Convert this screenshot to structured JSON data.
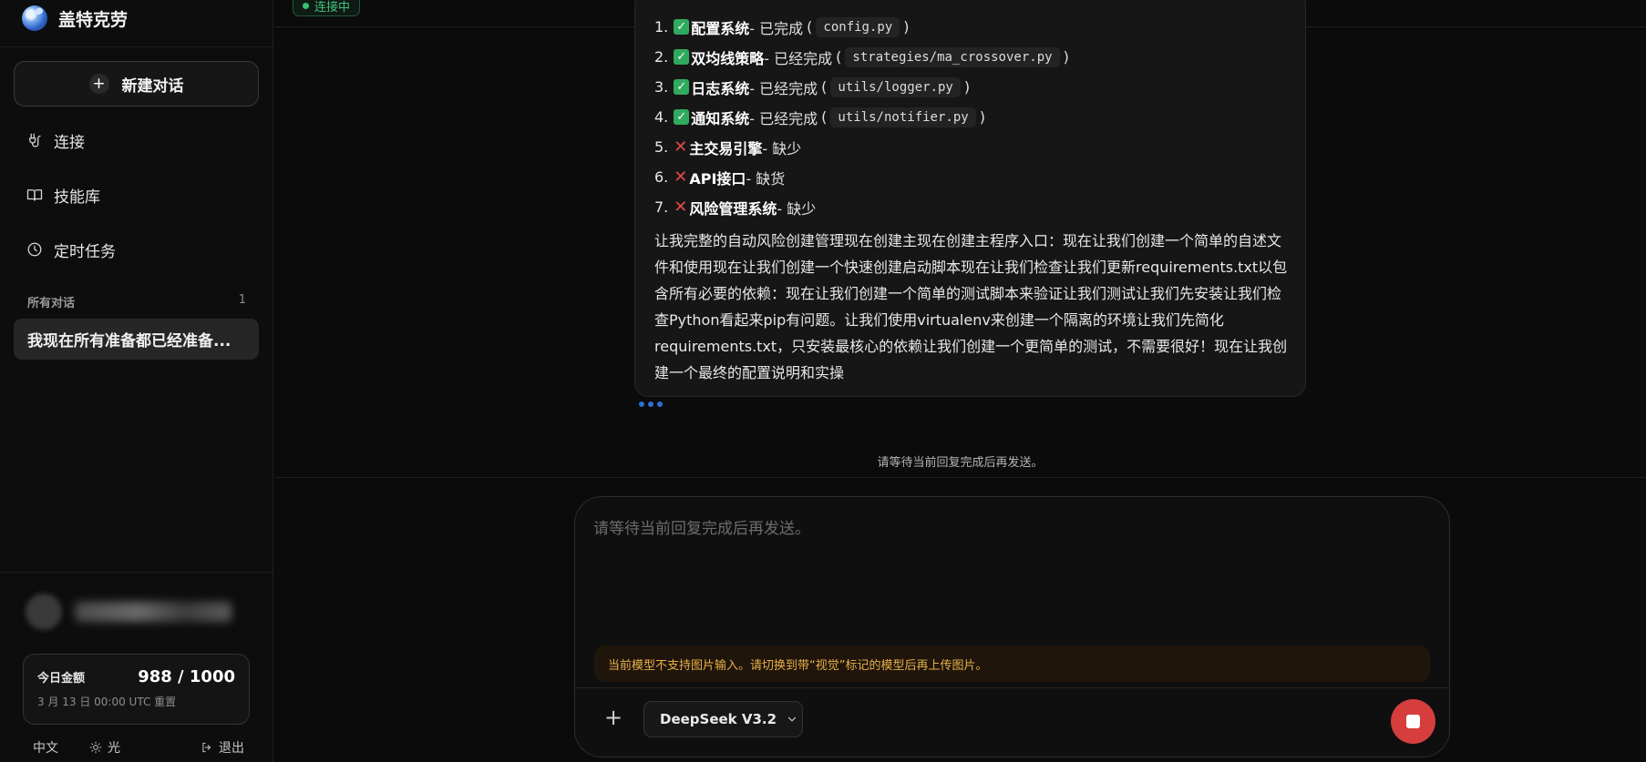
{
  "app": {
    "name": "盖特克劳"
  },
  "sidebar": {
    "new_chat_label": "新建对话",
    "nav": [
      {
        "label": "连接",
        "icon": "plug-icon"
      },
      {
        "label": "技能库",
        "icon": "book-icon"
      },
      {
        "label": "定时任务",
        "icon": "clock-icon"
      }
    ],
    "conversations_header": "所有对话",
    "conversations_count": "1",
    "conversations": [
      {
        "title": "我现在所有准备都已经准备..."
      }
    ],
    "quota": {
      "label": "今日金额",
      "value": "988 / 1000",
      "reset": "3 月 13 日 00:00 UTC 重置"
    },
    "footer": {
      "language": "中文",
      "theme": "光",
      "logout": "退出"
    }
  },
  "header": {
    "status": "连接中",
    "status_color": "#36c271"
  },
  "message": {
    "items": [
      {
        "num": "1.",
        "mark": "ok",
        "title": "配置系统",
        "status": "- 已完成",
        "code": "config.py"
      },
      {
        "num": "2.",
        "mark": "ok",
        "title": "双均线策略",
        "status": "- 已经完成",
        "code": "strategies/ma_crossover.py"
      },
      {
        "num": "3.",
        "mark": "ok",
        "title": "日志系统",
        "status": "- 已经完成",
        "code": "utils/logger.py"
      },
      {
        "num": "4.",
        "mark": "ok",
        "title": "通知系统",
        "status": "- 已经完成",
        "code": "utils/notifier.py"
      },
      {
        "num": "5.",
        "mark": "no",
        "title": "主交易引擎",
        "status": "- 缺少"
      },
      {
        "num": "6.",
        "mark": "no",
        "title": " API接口",
        "status": "- 缺货"
      },
      {
        "num": "7.",
        "mark": "no",
        "title": "风险管理系统",
        "status": "- 缺少"
      }
    ],
    "paragraph": "让我完整的自动风险创建管理现在创建主现在创建主程序入口：现在让我们创建一个简单的自述文件和使用现在让我们创建一个快速创建启动脚本现在让我们检查让我们更新requirements.txt以包含所有必要的依赖：现在让我们创建一个简单的测试脚本来验证让我们测试让我们先安装让我们检查Python看起来pip有问题。让我们使用virtualenv来创建一个隔离的环境让我们先简化requirements.txt，只安装最核心的依赖让我们创建一个更简单的测试，不需要很好！现在让我创建一个最终的配置说明和实操"
  },
  "wait_hint": "请等待当前回复完成后再发送。",
  "composer": {
    "placeholder": "请等待当前回复完成后再发送。",
    "warning": "当前模型不支持图片输入。请切换到带“视觉”标记的模型后再上传图片。",
    "attach_label": "+",
    "model": "DeepSeek V3.2",
    "stop_color": "#d63e3e"
  }
}
